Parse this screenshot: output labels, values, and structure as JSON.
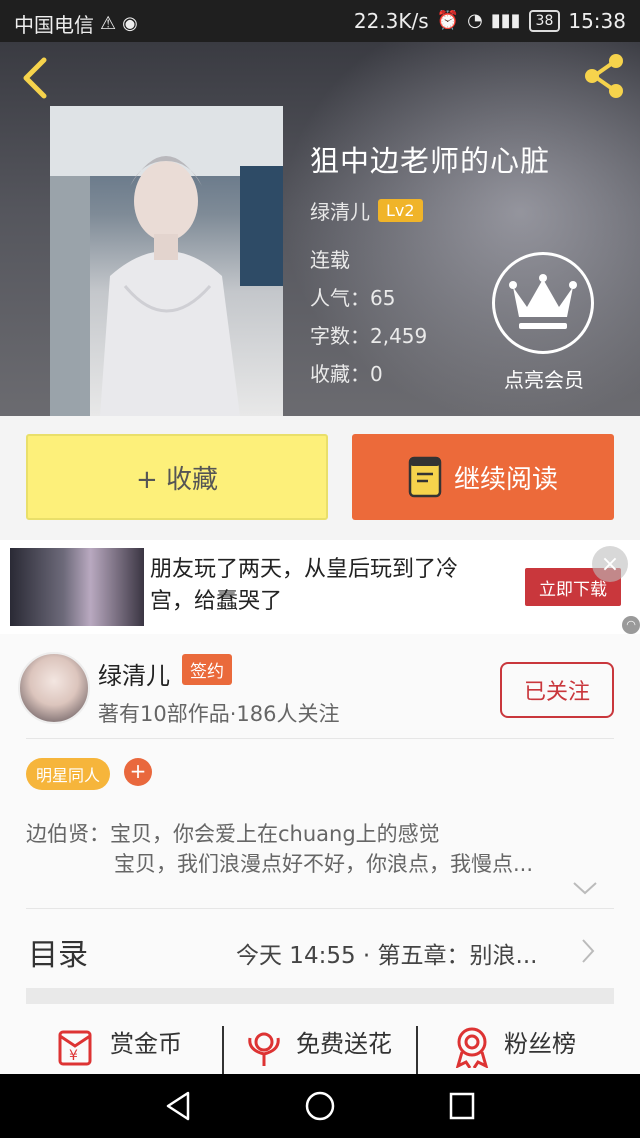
{
  "status_bar": {
    "carrier": "中国电信",
    "speed": "22.3K/s",
    "network": "4G 2G",
    "battery": "38",
    "time": "15:38"
  },
  "book": {
    "title": "狙中边老师的心脏",
    "author": "绿清儿",
    "level": "Lv2",
    "status": "连载",
    "popularity": "人气：65",
    "word_count": "字数：2,459",
    "favorites": "收藏：0",
    "vip_label": "点亮会员"
  },
  "actions": {
    "collect_label": "+ 收藏",
    "read_label": "继续阅读"
  },
  "ad": {
    "text": "朋友玩了两天，从皇后玩到了冷宫，给蠢哭了",
    "button_label": "立即下载",
    "close_label": "×"
  },
  "author_card": {
    "name": "绿清儿",
    "badge": "签约",
    "stats": "著有10部作品·186人关注",
    "follow_label": "已关注"
  },
  "tags": {
    "items": [
      "明星同人"
    ],
    "add_label": "+"
  },
  "intro": {
    "line1": "边伯贤：宝贝，你会爱上在chuang上的感觉",
    "line2": "宝贝，我们浪漫点好不好，你浪点，我慢点..."
  },
  "toc": {
    "label": "目录",
    "latest": "今天 14:55 · 第五章：别浪..."
  },
  "bottom": {
    "items": [
      {
        "label": "赏金币",
        "icon": "red-envelope-icon"
      },
      {
        "label": "免费送花",
        "icon": "flower-icon"
      },
      {
        "label": "粉丝榜",
        "icon": "medal-icon"
      }
    ]
  },
  "colors": {
    "accent_orange": "#ec6a3a",
    "collect_yellow": "#fdf07a",
    "level_gold": "#f0b429",
    "follow_red": "#c9373c"
  }
}
